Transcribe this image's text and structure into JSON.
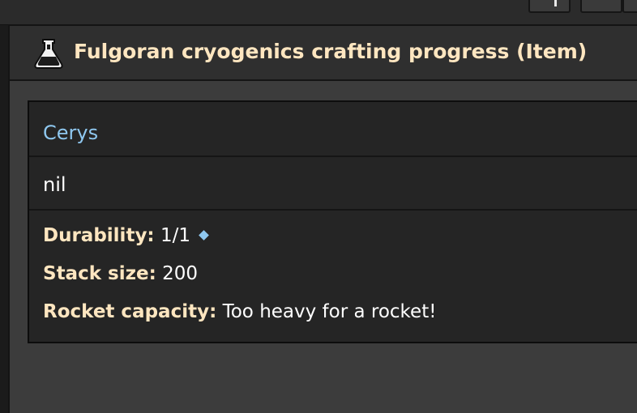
{
  "window": {
    "title": "Fulgoran cryogenics crafting progress (Item)",
    "icon": "flask-icon"
  },
  "tooltip": {
    "mod_name": "Cerys",
    "description": "nil",
    "properties": [
      {
        "label": "Durability:",
        "value": "1/1"
      },
      {
        "label": "Stack size:",
        "value": "200"
      },
      {
        "label": "Rocket capacity:",
        "value": "Too heavy for a rocket!"
      }
    ]
  },
  "colors": {
    "title": "#ffe6c0",
    "mod_name": "#8fc8f0",
    "value_text": "#ffffff",
    "panel_bg": "#252525",
    "window_bg": "#3c3c3c"
  }
}
